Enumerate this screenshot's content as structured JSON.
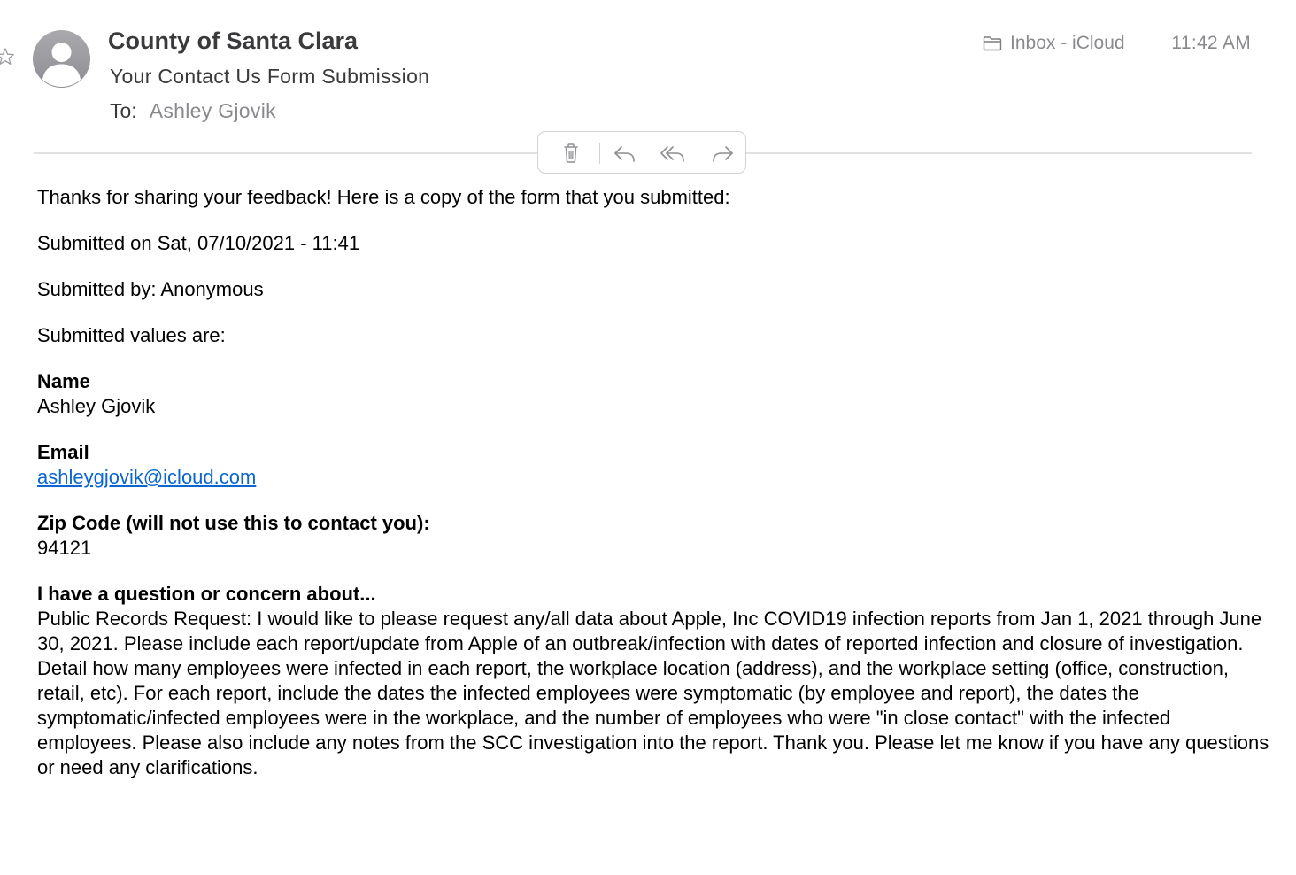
{
  "header": {
    "sender": "County of Santa Clara",
    "subject": "Your Contact Us Form Submission",
    "to_label": "To:",
    "to_value": "Ashley Gjovik",
    "mailbox": "Inbox - iCloud",
    "time": "11:42 AM"
  },
  "toolbar": {
    "icons": [
      "trash-icon",
      "reply-icon",
      "reply-all-icon",
      "forward-icon"
    ]
  },
  "body": {
    "intro": "Thanks for sharing your feedback! Here is a copy of the form that you submitted:",
    "submitted_on": "Submitted on Sat, 07/10/2021 - 11:41",
    "submitted_by": "Submitted by: Anonymous",
    "submitted_values": "Submitted values are:",
    "fields": [
      {
        "label": "Name",
        "value": "Ashley Gjovik"
      },
      {
        "label": "Email",
        "value": "ashleygjovik@icloud.com"
      },
      {
        "label": "Zip Code (will not use this to contact you):",
        "value": "94121"
      },
      {
        "label": "I have a question or concern about...",
        "value": "Public Records Request: I would like to please request any/all data about Apple, Inc COVID19 infection reports from Jan 1, 2021 through June 30, 2021. Please include each report/update from Apple of an outbreak/infection with dates of reported infection and closure of investigation. Detail how many employees were infected in each report, the workplace location (address), and the workplace setting (office, construction, retail, etc). For each report, include the dates the infected employees were symptomatic (by employee and report), the dates the symptomatic/infected employees were in the workplace, and the number of employees who were \"in close contact\" with the infected employees. Please also include any notes from the SCC investigation into the report. Thank you. Please let me know if you have any questions or need any clarifications."
      }
    ]
  },
  "colors": {
    "link": "#0a66d0",
    "muted_text": "#8a8a8e",
    "header_text": "#3a3a3c",
    "avatar": "#9a9aa0"
  }
}
